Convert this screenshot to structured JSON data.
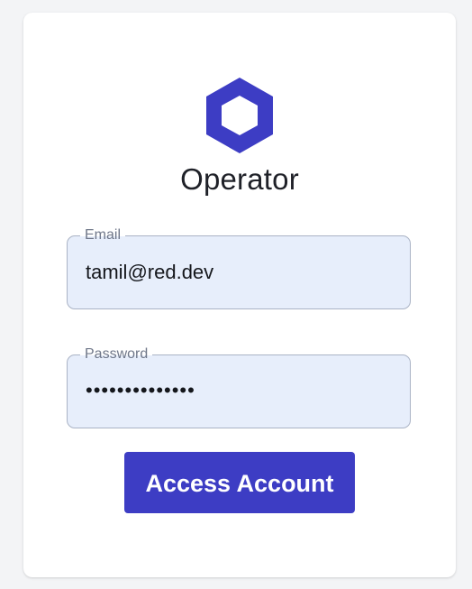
{
  "app": {
    "title": "Operator",
    "logo_icon": "hexagon-logo-icon",
    "brand_color": "#3d3dc4"
  },
  "form": {
    "email": {
      "label": "Email",
      "value": "tamil@red.dev"
    },
    "password": {
      "label": "Password",
      "value_masked": "••••••••••••••"
    },
    "submit_label": "Access Account"
  }
}
